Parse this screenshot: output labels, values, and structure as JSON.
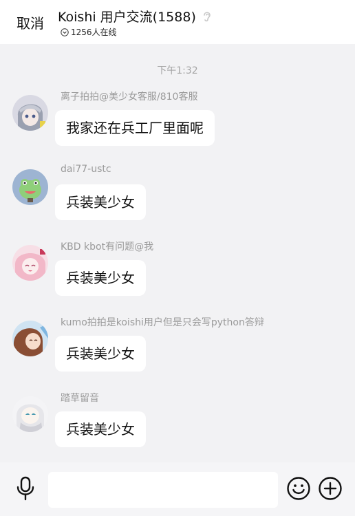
{
  "header": {
    "cancel_label": "取消",
    "title": "Koishi 用户交流(1588)",
    "online": "1256人在线"
  },
  "chat": {
    "timestamp": "下午1:32",
    "messages": [
      {
        "sender": "离子拍拍@美少女客服/810客服",
        "text": "我家还在兵工厂里面呢",
        "avatar": "anime-avatar"
      },
      {
        "sender": "dai77-ustc",
        "text": "兵装美少女",
        "avatar": "frog-avatar"
      },
      {
        "sender": "KBD kbot有问题@我",
        "text": "兵装美少女",
        "avatar": "pink-anime-avatar"
      },
      {
        "sender": "kumo拍拍是koishi用户但是只会写python答辩",
        "text": "兵装美少女",
        "avatar": "brown-hair-avatar"
      },
      {
        "sender": "踏草留音",
        "text": "兵装美少女",
        "avatar": "white-anime-avatar"
      }
    ]
  },
  "input": {
    "placeholder": "",
    "icons": [
      "mic-icon",
      "emoji-icon",
      "plus-icon"
    ]
  }
}
